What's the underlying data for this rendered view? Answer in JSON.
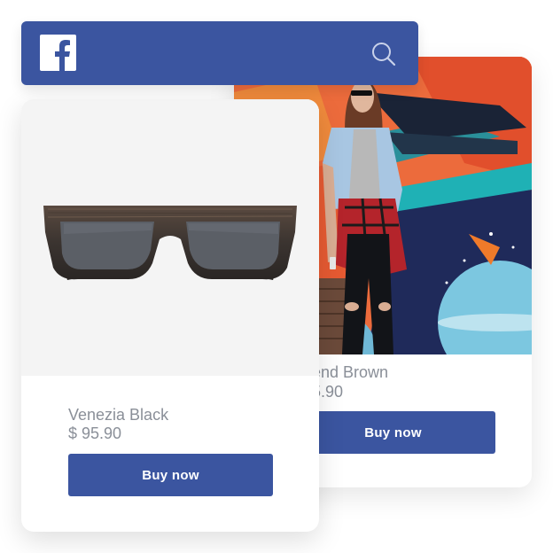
{
  "header": {
    "logo_icon": "facebook-logo-icon",
    "search_icon": "search-icon",
    "bar_color": "#3b55a0"
  },
  "products": {
    "front": {
      "name": "Venezia Black",
      "price": "$ 95.90",
      "button_label": "Buy now",
      "image": "sunglasses"
    },
    "back": {
      "name": "end Brown",
      "price": "5.90",
      "button_label": "Buy now",
      "image": "woman-in-front-of-mural-photo"
    }
  },
  "colors": {
    "brand": "#3b55a0",
    "text_muted": "#8a8f98",
    "card_bg": "#ffffff"
  }
}
